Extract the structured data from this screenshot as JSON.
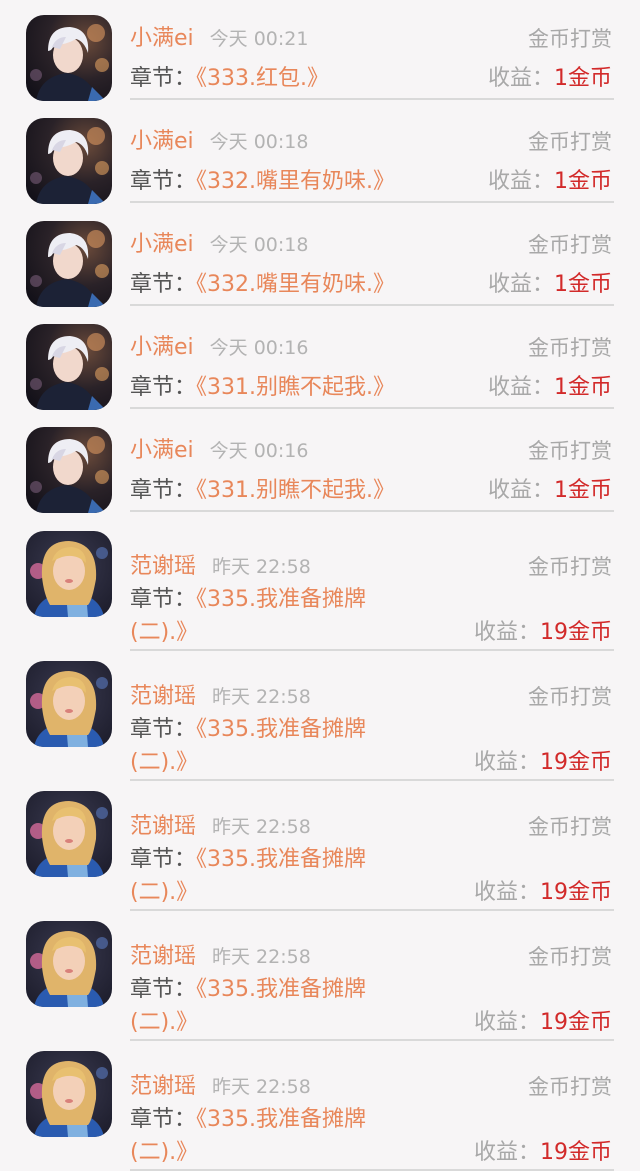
{
  "colors": {
    "name": "#e8875a",
    "chapter_title": "#e8875a",
    "income_value": "#d22a2a",
    "muted": "#a8a8a8",
    "background": "#f7f5f6"
  },
  "records": [
    {
      "avatar": "avatar-white-hair-boy",
      "name": "小满ei",
      "time": "今天 00:21",
      "type": "金币打赏",
      "chapter_label": "章节：",
      "chapter_line1": "《333.红包.》",
      "chapter_line2": "",
      "income_label": "收益：",
      "income_value": "1金币"
    },
    {
      "avatar": "avatar-white-hair-boy",
      "name": "小满ei",
      "time": "今天 00:18",
      "type": "金币打赏",
      "chapter_label": "章节：",
      "chapter_line1": "《332.嘴里有奶味.》",
      "chapter_line2": "",
      "income_label": "收益：",
      "income_value": "1金币"
    },
    {
      "avatar": "avatar-white-hair-boy",
      "name": "小满ei",
      "time": "今天 00:18",
      "type": "金币打赏",
      "chapter_label": "章节：",
      "chapter_line1": "《332.嘴里有奶味.》",
      "chapter_line2": "",
      "income_label": "收益：",
      "income_value": "1金币"
    },
    {
      "avatar": "avatar-white-hair-boy",
      "name": "小满ei",
      "time": "今天 00:16",
      "type": "金币打赏",
      "chapter_label": "章节：",
      "chapter_line1": "《331.别瞧不起我.》",
      "chapter_line2": "",
      "income_label": "收益：",
      "income_value": "1金币"
    },
    {
      "avatar": "avatar-white-hair-boy",
      "name": "小满ei",
      "time": "今天 00:16",
      "type": "金币打赏",
      "chapter_label": "章节：",
      "chapter_line1": "《331.别瞧不起我.》",
      "chapter_line2": "",
      "income_label": "收益：",
      "income_value": "1金币"
    },
    {
      "avatar": "avatar-blonde-girl",
      "name": "范谢瑶",
      "time": "昨天 22:58",
      "type": "金币打赏",
      "chapter_label": "章节：",
      "chapter_line1": "《335.我准备摊牌",
      "chapter_line2": "(二).》",
      "income_label": "收益：",
      "income_value": "19金币"
    },
    {
      "avatar": "avatar-blonde-girl",
      "name": "范谢瑶",
      "time": "昨天 22:58",
      "type": "金币打赏",
      "chapter_label": "章节：",
      "chapter_line1": "《335.我准备摊牌",
      "chapter_line2": "(二).》",
      "income_label": "收益：",
      "income_value": "19金币"
    },
    {
      "avatar": "avatar-blonde-girl",
      "name": "范谢瑶",
      "time": "昨天 22:58",
      "type": "金币打赏",
      "chapter_label": "章节：",
      "chapter_line1": "《335.我准备摊牌",
      "chapter_line2": "(二).》",
      "income_label": "收益：",
      "income_value": "19金币"
    },
    {
      "avatar": "avatar-blonde-girl",
      "name": "范谢瑶",
      "time": "昨天 22:58",
      "type": "金币打赏",
      "chapter_label": "章节：",
      "chapter_line1": "《335.我准备摊牌",
      "chapter_line2": "(二).》",
      "income_label": "收益：",
      "income_value": "19金币"
    },
    {
      "avatar": "avatar-blonde-girl",
      "name": "范谢瑶",
      "time": "昨天 22:58",
      "type": "金币打赏",
      "chapter_label": "章节：",
      "chapter_line1": "《335.我准备摊牌",
      "chapter_line2": "(二).》",
      "income_label": "收益：",
      "income_value": "19金币"
    }
  ]
}
